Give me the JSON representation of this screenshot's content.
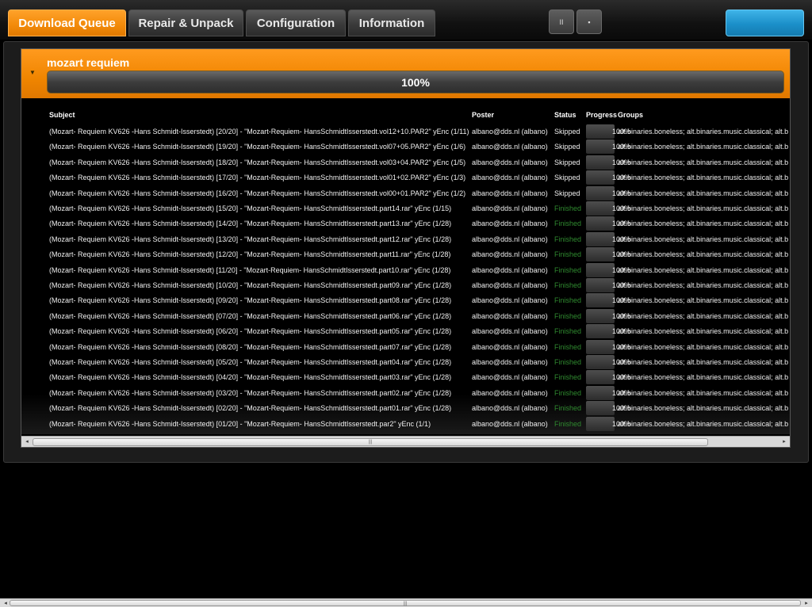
{
  "tabs": [
    {
      "label": "Download Queue",
      "active": true
    },
    {
      "label": "Repair & Unpack",
      "active": false
    },
    {
      "label": "Configuration",
      "active": false
    },
    {
      "label": "Information",
      "active": false
    }
  ],
  "toolbar": {
    "pause_glyph": "II",
    "save_glyph": "▪"
  },
  "group": {
    "title": "mozart requiem",
    "progress_text": "100%",
    "progress": 1.0
  },
  "columns": {
    "subject": "Subject",
    "poster": "Poster",
    "status": "Status",
    "progress": "Progress",
    "groups": "Groups"
  },
  "rows": [
    {
      "subject": "(Mozart- Requiem KV626 -Hans Schmidt-Isserstedt) [20/20] - \"Mozart-Requiem- HansSchmidtIsserstedt.vol12+10.PAR2\" yEnc (1/11)",
      "poster": "albano@dds.nl (albano)",
      "status": "Skipped",
      "progress": "100%",
      "groups": "alt.binaries.boneless; alt.binaries.music.classical; alt.b"
    },
    {
      "subject": "(Mozart- Requiem KV626 -Hans Schmidt-Isserstedt) [19/20] - \"Mozart-Requiem- HansSchmidtIsserstedt.vol07+05.PAR2\" yEnc (1/6)",
      "poster": "albano@dds.nl (albano)",
      "status": "Skipped",
      "progress": "100%",
      "groups": "alt.binaries.boneless; alt.binaries.music.classical; alt.b"
    },
    {
      "subject": "(Mozart- Requiem KV626 -Hans Schmidt-Isserstedt) [18/20] - \"Mozart-Requiem- HansSchmidtIsserstedt.vol03+04.PAR2\" yEnc (1/5)",
      "poster": "albano@dds.nl (albano)",
      "status": "Skipped",
      "progress": "100%",
      "groups": "alt.binaries.boneless; alt.binaries.music.classical; alt.b"
    },
    {
      "subject": "(Mozart- Requiem KV626 -Hans Schmidt-Isserstedt) [17/20] - \"Mozart-Requiem- HansSchmidtIsserstedt.vol01+02.PAR2\" yEnc (1/3)",
      "poster": "albano@dds.nl (albano)",
      "status": "Skipped",
      "progress": "100%",
      "groups": "alt.binaries.boneless; alt.binaries.music.classical; alt.b"
    },
    {
      "subject": "(Mozart- Requiem KV626 -Hans Schmidt-Isserstedt) [16/20] - \"Mozart-Requiem- HansSchmidtIsserstedt.vol00+01.PAR2\" yEnc (1/2)",
      "poster": "albano@dds.nl (albano)",
      "status": "Skipped",
      "progress": "100%",
      "groups": "alt.binaries.boneless; alt.binaries.music.classical; alt.b"
    },
    {
      "subject": "(Mozart- Requiem KV626 -Hans Schmidt-Isserstedt) [15/20] - \"Mozart-Requiem- HansSchmidtIsserstedt.part14.rar\" yEnc (1/15)",
      "poster": "albano@dds.nl (albano)",
      "status": "Finished",
      "progress": "100%",
      "groups": "alt.binaries.boneless; alt.binaries.music.classical; alt.b"
    },
    {
      "subject": "(Mozart- Requiem KV626 -Hans Schmidt-Isserstedt) [14/20] - \"Mozart-Requiem- HansSchmidtIsserstedt.part13.rar\" yEnc (1/28)",
      "poster": "albano@dds.nl (albano)",
      "status": "Finished",
      "progress": "100%",
      "groups": "alt.binaries.boneless; alt.binaries.music.classical; alt.b"
    },
    {
      "subject": "(Mozart- Requiem KV626 -Hans Schmidt-Isserstedt) [13/20] - \"Mozart-Requiem- HansSchmidtIsserstedt.part12.rar\" yEnc (1/28)",
      "poster": "albano@dds.nl (albano)",
      "status": "Finished",
      "progress": "100%",
      "groups": "alt.binaries.boneless; alt.binaries.music.classical; alt.b"
    },
    {
      "subject": "(Mozart- Requiem KV626 -Hans Schmidt-Isserstedt) [12/20] - \"Mozart-Requiem- HansSchmidtIsserstedt.part11.rar\" yEnc (1/28)",
      "poster": "albano@dds.nl (albano)",
      "status": "Finished",
      "progress": "100%",
      "groups": "alt.binaries.boneless; alt.binaries.music.classical; alt.b"
    },
    {
      "subject": "(Mozart- Requiem KV626 -Hans Schmidt-Isserstedt) [11/20] - \"Mozart-Requiem- HansSchmidtIsserstedt.part10.rar\" yEnc (1/28)",
      "poster": "albano@dds.nl (albano)",
      "status": "Finished",
      "progress": "100%",
      "groups": "alt.binaries.boneless; alt.binaries.music.classical; alt.b"
    },
    {
      "subject": "(Mozart- Requiem KV626 -Hans Schmidt-Isserstedt) [10/20] - \"Mozart-Requiem- HansSchmidtIsserstedt.part09.rar\" yEnc (1/28)",
      "poster": "albano@dds.nl (albano)",
      "status": "Finished",
      "progress": "100%",
      "groups": "alt.binaries.boneless; alt.binaries.music.classical; alt.b"
    },
    {
      "subject": "(Mozart- Requiem KV626 -Hans Schmidt-Isserstedt) [09/20] - \"Mozart-Requiem- HansSchmidtIsserstedt.part08.rar\" yEnc (1/28)",
      "poster": "albano@dds.nl (albano)",
      "status": "Finished",
      "progress": "100%",
      "groups": "alt.binaries.boneless; alt.binaries.music.classical; alt.b"
    },
    {
      "subject": "(Mozart- Requiem KV626 -Hans Schmidt-Isserstedt) [07/20] - \"Mozart-Requiem- HansSchmidtIsserstedt.part06.rar\" yEnc (1/28)",
      "poster": "albano@dds.nl (albano)",
      "status": "Finished",
      "progress": "100%",
      "groups": "alt.binaries.boneless; alt.binaries.music.classical; alt.b"
    },
    {
      "subject": "(Mozart- Requiem KV626 -Hans Schmidt-Isserstedt) [06/20] - \"Mozart-Requiem- HansSchmidtIsserstedt.part05.rar\" yEnc (1/28)",
      "poster": "albano@dds.nl (albano)",
      "status": "Finished",
      "progress": "100%",
      "groups": "alt.binaries.boneless; alt.binaries.music.classical; alt.b"
    },
    {
      "subject": "(Mozart- Requiem KV626 -Hans Schmidt-Isserstedt) [08/20] - \"Mozart-Requiem- HansSchmidtIsserstedt.part07.rar\" yEnc (1/28)",
      "poster": "albano@dds.nl (albano)",
      "status": "Finished",
      "progress": "100%",
      "groups": "alt.binaries.boneless; alt.binaries.music.classical; alt.b"
    },
    {
      "subject": "(Mozart- Requiem KV626 -Hans Schmidt-Isserstedt) [05/20] - \"Mozart-Requiem- HansSchmidtIsserstedt.part04.rar\" yEnc (1/28)",
      "poster": "albano@dds.nl (albano)",
      "status": "Finished",
      "progress": "100%",
      "groups": "alt.binaries.boneless; alt.binaries.music.classical; alt.b"
    },
    {
      "subject": "(Mozart- Requiem KV626 -Hans Schmidt-Isserstedt) [04/20] - \"Mozart-Requiem- HansSchmidtIsserstedt.part03.rar\" yEnc (1/28)",
      "poster": "albano@dds.nl (albano)",
      "status": "Finished",
      "progress": "100%",
      "groups": "alt.binaries.boneless; alt.binaries.music.classical; alt.b"
    },
    {
      "subject": "(Mozart- Requiem KV626 -Hans Schmidt-Isserstedt) [03/20] - \"Mozart-Requiem- HansSchmidtIsserstedt.part02.rar\" yEnc (1/28)",
      "poster": "albano@dds.nl (albano)",
      "status": "Finished",
      "progress": "100%",
      "groups": "alt.binaries.boneless; alt.binaries.music.classical; alt.b"
    },
    {
      "subject": "(Mozart- Requiem KV626 -Hans Schmidt-Isserstedt) [02/20] - \"Mozart-Requiem- HansSchmidtIsserstedt.part01.rar\" yEnc (1/28)",
      "poster": "albano@dds.nl (albano)",
      "status": "Finished",
      "progress": "100%",
      "groups": "alt.binaries.boneless; alt.binaries.music.classical; alt.b"
    },
    {
      "subject": "(Mozart- Requiem KV626 -Hans Schmidt-Isserstedt) [01/20] - \"Mozart-Requiem- HansSchmidtIsserstedt.par2\" yEnc (1/1)",
      "poster": "albano@dds.nl (albano)",
      "status": "Finished",
      "progress": "100%",
      "groups": "alt.binaries.boneless; alt.binaries.music.classical; alt.b"
    }
  ],
  "scroll": {
    "left_glyph": "◂",
    "right_glyph": "▸",
    "grip_glyph": "|||"
  },
  "colors": {
    "accent_orange": "#f28a0a",
    "action_blue": "#1b8fc9",
    "finished_green": "#2f8a2f"
  }
}
